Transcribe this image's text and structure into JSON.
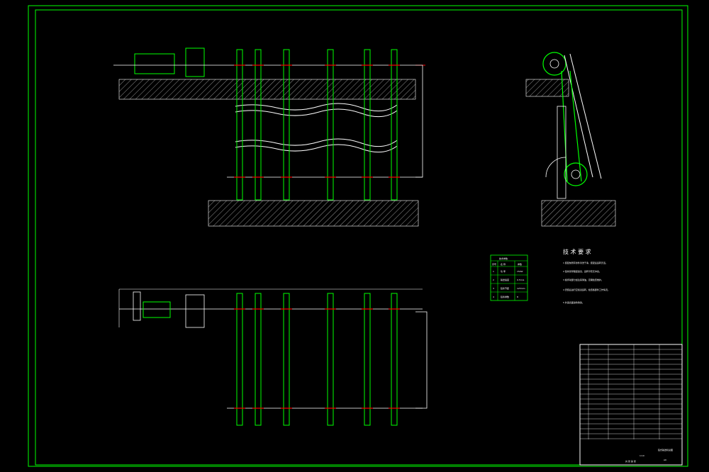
{
  "tech_req": {
    "title": "技 术 要 求",
    "notes": [
      "1 装配前所有零件清洗干净，装配后运转灵活。",
      "2 链条张紧程度适当，运转平稳无冲击。",
      "3 各传动部分加注润滑油，定期检查维护。",
      "4 安装后进行空载试运转，检查各部件工作情况。",
      "5 外露表面涂防锈漆。"
    ]
  },
  "params_table": {
    "title": "技术参数",
    "headers": [
      "序号",
      "名 称",
      "参数"
    ],
    "rows": [
      [
        "1",
        "功 率",
        "15kW"
      ],
      [
        "2",
        "输送速度",
        "0.5m/s"
      ],
      [
        "3",
        "链条节距",
        "125mm"
      ],
      [
        "4",
        "链条排数",
        "8"
      ]
    ]
  },
  "title_block": {
    "drawing_title": "链式输送机总图",
    "drawing_no": "A0",
    "scale": "1:10",
    "sheet": "共 张 第 张"
  },
  "colors": {
    "background": "#000000",
    "frame": "#00ff00",
    "line_white": "#ffffff",
    "line_green": "#00ff00",
    "accent_red": "#ff0000",
    "hatch": "#bbbbbb"
  }
}
